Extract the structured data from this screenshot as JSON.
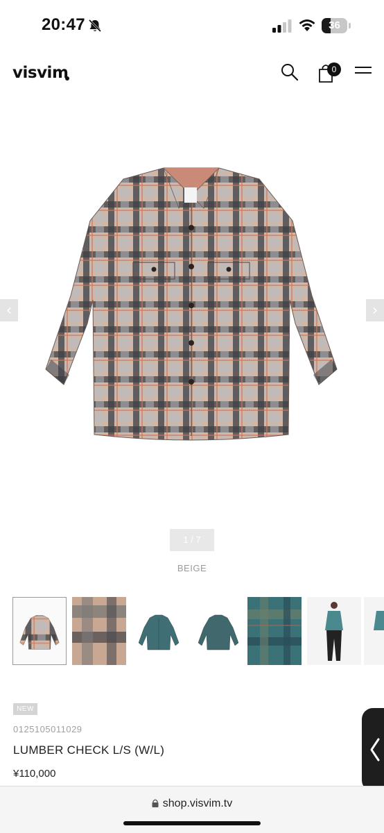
{
  "status_bar": {
    "time": "20:47",
    "battery_level": "36",
    "battery_fraction": 0.36
  },
  "header": {
    "logo": "visvim",
    "cart_count": "0",
    "icons": [
      "search-icon",
      "cart-icon",
      "hamburger-menu-icon"
    ]
  },
  "gallery": {
    "counter": "1 / 7",
    "color": "BEIGE",
    "main_image": "beige-plaid-shirt",
    "thumbnails": [
      "beige-shirt",
      "beige-fabric-closeup",
      "green-shirt-front",
      "green-shirt-back",
      "green-fabric-closeup",
      "model-green-shirt"
    ]
  },
  "product": {
    "badge": "NEW",
    "sku": "0125105011029",
    "name": "LUMBER CHECK L/S (W/L)",
    "price": "¥110,000"
  },
  "browser": {
    "url": "shop.visvim.tv"
  },
  "colors": {
    "shirt_beige": "#c9a48e",
    "shirt_dark": "#3c3e45",
    "shirt_green": "#3f6f74",
    "badge_bg": "#d4d4d4"
  }
}
